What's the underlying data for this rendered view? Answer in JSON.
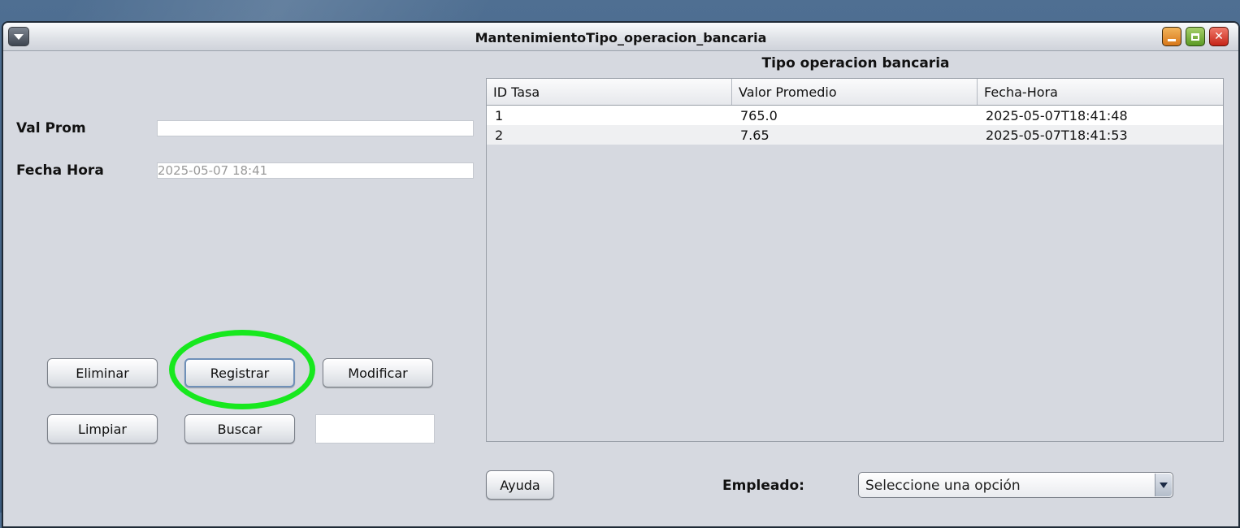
{
  "window": {
    "title": "MantenimientoTipo_operacion_bancaria"
  },
  "form": {
    "val_prom_label": "Val Prom",
    "val_prom_value": "",
    "fecha_hora_label": "Fecha Hora",
    "fecha_hora_value": "2025-05-07 18:41"
  },
  "buttons": {
    "eliminar": "Eliminar",
    "registrar": "Registrar",
    "modificar": "Modificar",
    "limpiar": "Limpiar",
    "buscar": "Buscar",
    "ayuda": "Ayuda"
  },
  "search": {
    "value": ""
  },
  "table": {
    "title": "Tipo operacion bancaria",
    "columns": [
      "ID Tasa",
      "Valor Promedio",
      "Fecha-Hora"
    ],
    "rows": [
      [
        "1",
        "765.0",
        "2025-05-07T18:41:48"
      ],
      [
        "2",
        "7.65",
        "2025-05-07T18:41:53"
      ]
    ]
  },
  "empleado": {
    "label": "Empleado:",
    "selected": "Seleccione una opción"
  },
  "annotation": {
    "highlight_color": "#17e81e",
    "target": "Registrar"
  }
}
